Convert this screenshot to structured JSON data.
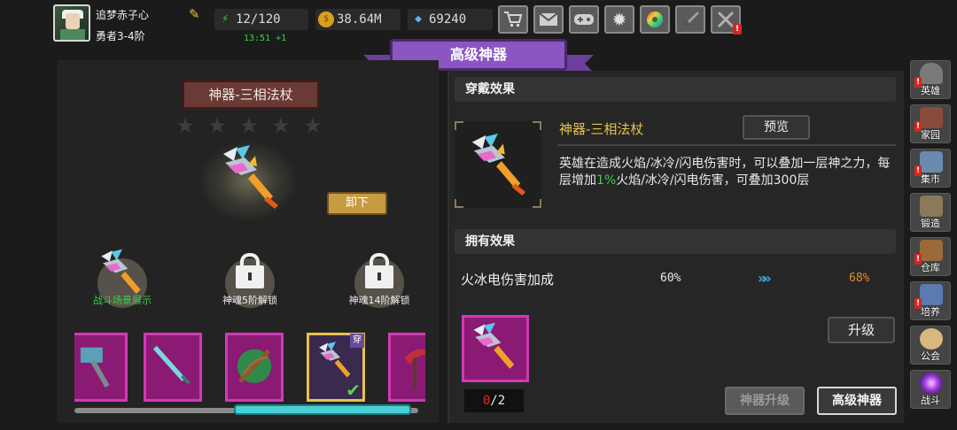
{
  "player": {
    "name": "追梦赤子心",
    "rank": "勇者3-4阶"
  },
  "resources": {
    "energy": "12/120",
    "energy_timer": "13:51 +1",
    "gold": "38.64M",
    "gems": "69240"
  },
  "toolbar": {
    "icons": [
      "shop-cart-icon",
      "mail-icon",
      "gamepad-icon",
      "gear-icon",
      "color-wheel-icon",
      "sword-icon",
      "crossed-swords-icon"
    ]
  },
  "header": {
    "title": "高级神器"
  },
  "artifact": {
    "name": "神器-三相法杖",
    "stars_filled": 0,
    "stars_total": 5,
    "unequip_label": "卸下"
  },
  "slots": [
    {
      "label": "战斗场景展示",
      "locked": false,
      "color": "#38d14b"
    },
    {
      "label": "神魂5阶解锁",
      "locked": true,
      "color": "#f0f0f0"
    },
    {
      "label": "神魂14阶解锁",
      "locked": true,
      "color": "#f0f0f0"
    }
  ],
  "carousel": {
    "selected_index": 3,
    "equipped_badge": "穿",
    "scroll_position": 0.68
  },
  "wear_effect": {
    "heading": "穿戴效果",
    "title": "神器-三相法杖",
    "preview_label": "预览",
    "desc_before": "英雄在造成火焰/冰冷/闪电伤害时，可以叠加一层神之力，每层增加",
    "desc_highlight": "1%",
    "desc_after": "火焰/冰冷/闪电伤害，可叠加300层"
  },
  "own_effect": {
    "heading": "拥有效果",
    "label": "火冰电伤害加成",
    "current": "60%",
    "next": "68%"
  },
  "upgrade": {
    "button_label": "升级",
    "count_have": "0",
    "count_sep": "/2"
  },
  "bottom_tabs": {
    "artifact_upgrade": "神器升级",
    "advanced_artifact": "高级神器"
  },
  "sidenav": [
    {
      "label": "英雄",
      "icon": "helmet-icon",
      "alert": true
    },
    {
      "label": "家园",
      "icon": "castle-icon",
      "alert": true
    },
    {
      "label": "集市",
      "icon": "merchant-icon",
      "alert": true
    },
    {
      "label": "锻造",
      "icon": "anvil-icon",
      "alert": false
    },
    {
      "label": "仓库",
      "icon": "warehouse-icon",
      "alert": true
    },
    {
      "label": "培养",
      "icon": "trophy-icon",
      "alert": true
    },
    {
      "label": "公会",
      "icon": "guild-icon",
      "alert": false
    },
    {
      "label": "战斗",
      "icon": "portal-icon",
      "alert": false
    }
  ],
  "colors": {
    "accent_gold": "#e5c34b",
    "highlight_green": "#38d14b",
    "card_magenta": "#8a1a74",
    "banner_purple": "#8a56c2"
  }
}
